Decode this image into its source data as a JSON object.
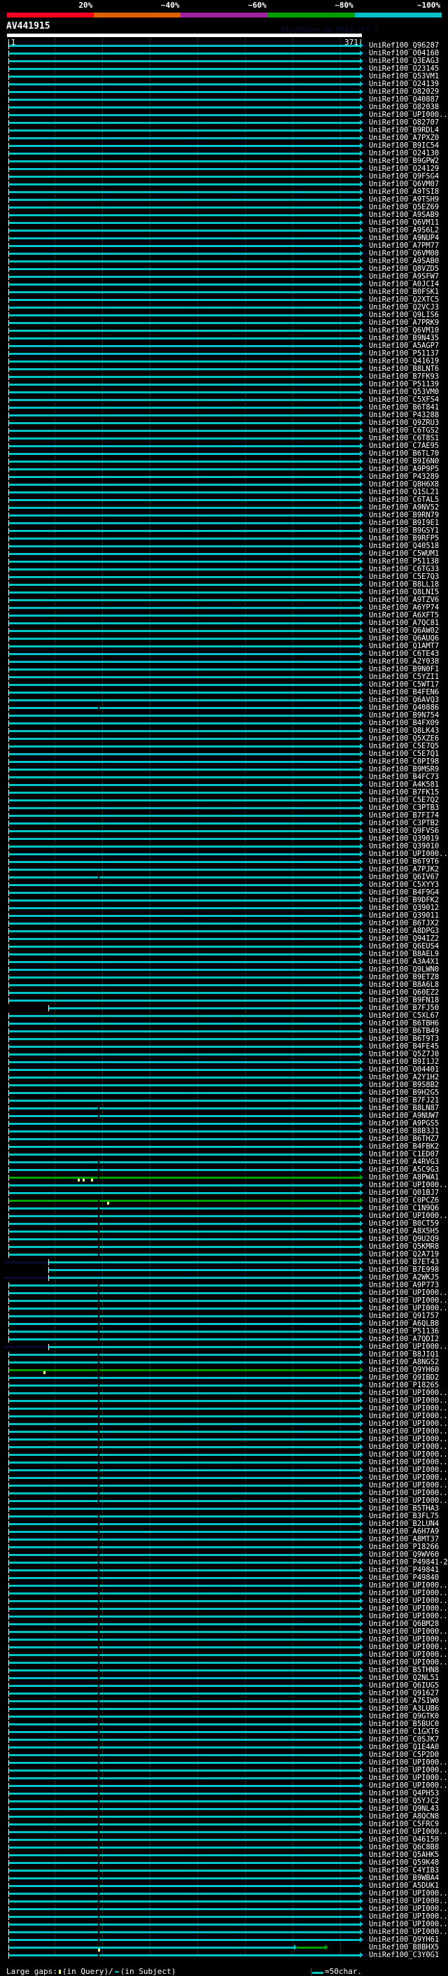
{
  "header": {
    "identity_legend": [
      {
        "label": "20%",
        "color": "#ff0020"
      },
      {
        "label": "~40%",
        "color": "#e06000"
      },
      {
        "label": "~60%",
        "color": "#a020a0"
      },
      {
        "label": "~80%",
        "color": "#00a000"
      },
      {
        "label": "~100%",
        "color": "#00c0c8"
      }
    ],
    "query_name": "AV441915",
    "version": "AlignView.pm Beta rel.7",
    "ruler_start": "|1",
    "ruler_end": "371|"
  },
  "query_length": 371,
  "grid_step": 50,
  "colors": {
    "hit": "#00c3c8",
    "green": "#00a000",
    "overhang": "#070a2e",
    "gap": "#ffff80"
  },
  "hits": [
    "UniRef100_Q96287",
    "UniRef100_O04160",
    "UniRef100_Q3EAG3",
    "UniRef100_O23145",
    "UniRef100_Q53VM1",
    "UniRef100_O24139",
    "UniRef100_O82029",
    "UniRef100_Q40887",
    "UniRef100_O82038",
    "UniRef100_UPI000..",
    "UniRef100_O82707",
    "UniRef100_B9RDL4",
    "UniRef100_A7PXZ0",
    "UniRef100_B9IC54",
    "UniRef100_O24130",
    "UniRef100_B9GPW2",
    "UniRef100_O24129",
    "UniRef100_Q9FSG4",
    "UniRef100_Q6VM07",
    "UniRef100_A9TSI8",
    "UniRef100_A9TSH9",
    "UniRef100_Q5EZ69",
    "UniRef100_A9SAB9",
    "UniRef100_Q6VM11",
    "UniRef100_A9S6L2",
    "UniRef100_A9NUP4",
    "UniRef100_A7PM77",
    "UniRef100_Q6VM08",
    "UniRef100_A9SAB0",
    "UniRef100_Q8VZD5",
    "UniRef100_A9SFW7",
    "UniRef100_A0JCI4",
    "UniRef100_B0FSK1",
    "UniRef100_Q2XTC5",
    "UniRef100_Q2VCJ3",
    "UniRef100_Q9LIS6",
    "UniRef100_A7PRK9",
    "UniRef100_Q6VM10",
    "UniRef100_B9N435",
    "UniRef100_A5AGP7",
    "UniRef100_P51137",
    "UniRef100_Q41619",
    "UniRef100_B8LNT6",
    "UniRef100_B7FK93",
    "UniRef100_P51139",
    "UniRef100_Q53VM0",
    "UniRef100_C5XFS4",
    "UniRef100_B6T841",
    "UniRef100_P43288",
    "UniRef100_Q9ZRU3",
    "UniRef100_C6TGS2",
    "UniRef100_C6T8S1",
    "UniRef100_C7AE95",
    "UniRef100_B6TL70",
    "UniRef100_B9I6N0",
    "UniRef100_A9P9P5",
    "UniRef100_P43289",
    "UniRef100_Q8H6X8",
    "UniRef100_Q1SL21",
    "UniRef100_C6TAL5",
    "UniRef100_A9NV52",
    "UniRef100_B9RN79",
    "UniRef100_B9I9E1",
    "UniRef100_B9GSY1",
    "UniRef100_B9RFP5",
    "UniRef100_Q40518",
    "UniRef100_C5WUM1",
    "UniRef100_P51138",
    "UniRef100_C6TG33",
    "UniRef100_C5E7Q3",
    "UniRef100_B8LL18",
    "UniRef100_Q8LNI5",
    "UniRef100_A9TZV6",
    "UniRef100_A6YP74",
    "UniRef100_A6XFT5",
    "UniRef100_A7QC81",
    "UniRef100_Q6AW02",
    "UniRef100_Q6AUQ6",
    "UniRef100_Q1AMT7",
    "UniRef100_C6TE43",
    "UniRef100_A2Y038",
    "UniRef100_B9N0F1",
    "UniRef100_C5YZI1",
    "UniRef100_C5WT17",
    "UniRef100_B4FEN6",
    "UniRef100_Q6AVQ3",
    "UniRef100_Q40886",
    "UniRef100_B9N754",
    "UniRef100_B4FX09",
    "UniRef100_Q8LK43",
    "UniRef100_Q5XZE6",
    "UniRef100_C5E7Q5",
    "UniRef100_C5E7Q1",
    "UniRef100_C0PI98",
    "UniRef100_B9MSR9",
    "UniRef100_B4FC73",
    "UniRef100_A4K581",
    "UniRef100_B7FK15",
    "UniRef100_C5E7Q2",
    "UniRef100_C3PTB3",
    "UniRef100_B7FI74",
    "UniRef100_C3PTB2",
    "UniRef100_Q9FVS6",
    "UniRef100_Q39019",
    "UniRef100_Q39010",
    "UniRef100_UPI000..",
    "UniRef100_B6T9T6",
    "UniRef100_A7PJK2",
    "UniRef100_Q6IV67",
    "UniRef100_C5XYY3",
    "UniRef100_B4F9G4",
    "UniRef100_B9DFK2",
    "UniRef100_Q39012",
    "UniRef100_Q39011",
    "UniRef100_B6TJX2",
    "UniRef100_A8DPG3",
    "UniRef100_Q94IZ2",
    "UniRef100_Q6EUS4",
    "UniRef100_B8AEL9",
    "UniRef100_A3A4X1",
    "UniRef100_Q9LWN0",
    "UniRef100_B9ETZ8",
    "UniRef100_B8A6L8",
    "UniRef100_Q60EZ2",
    "UniRef100_B9FN18",
    "UniRef100_B7FJ50",
    "UniRef100_C5XL67",
    "UniRef100_B6TBH6",
    "UniRef100_B6TB49",
    "UniRef100_B6T9T3",
    "UniRef100_B4FE45",
    "UniRef100_Q5Z7J0",
    "UniRef100_B9I1J2",
    "UniRef100_O04401",
    "UniRef100_A2Y1H2",
    "UniRef100_B9S8B2",
    "UniRef100_B9H2G5",
    "UniRef100_B7FJ21",
    "UniRef100_B8LN87",
    "UniRef100_A9NUW7",
    "UniRef100_A9PGS5",
    "UniRef100_B8B3J1",
    "UniRef100_B6THZ7",
    "UniRef100_B4FBK2",
    "UniRef100_C1ED07",
    "UniRef100_A4RVG3",
    "UniRef100_A5C9G3",
    "UniRef100_A8PWA1",
    "UniRef100_UPI000..",
    "UniRef100_Q01BJ7",
    "UniRef100_C0PCZ6",
    "UniRef100_C1N9Q6",
    "UniRef100_UPI000..",
    "UniRef100_B0CT59",
    "UniRef100_A8X5H5",
    "UniRef100_Q9U2Q9",
    "UniRef100_Q5KMR8",
    "UniRef100_Q2A719",
    "UniRef100_B7ET43",
    "UniRef100_B7E998",
    "UniRef100_A2WKJ5",
    "UniRef100_A9P773",
    "UniRef100_UPI000..",
    "UniRef100_UPI000..",
    "UniRef100_UPI000..",
    "UniRef100_Q91757",
    "UniRef100_A6QLB8",
    "UniRef100_P51136",
    "UniRef100_A7QDI2",
    "UniRef100_UPI000..",
    "UniRef100_B8JIQ1",
    "UniRef100_A8NGS2",
    "UniRef100_Q9YH60",
    "UniRef100_Q9IBD2",
    "UniRef100_P18265",
    "UniRef100_UPI000..",
    "UniRef100_UPI000..",
    "UniRef100_UPI000..",
    "UniRef100_UPI000..",
    "UniRef100_UPI000..",
    "UniRef100_UPI000..",
    "UniRef100_UPI000..",
    "UniRef100_UPI000..",
    "UniRef100_UPI000..",
    "UniRef100_UPI000..",
    "UniRef100_UPI000..",
    "UniRef100_UPI000..",
    "UniRef100_UPI000..",
    "UniRef100_UPI000..",
    "UniRef100_UPI000..",
    "UniRef100_B5THA3",
    "UniRef100_B3FL75",
    "UniRef100_B2LUN4",
    "UniRef100_A6H7A9",
    "UniRef100_A8MT37",
    "UniRef100_P18266",
    "UniRef100_Q9WV60",
    "UniRef100_P49841-2",
    "UniRef100_P49841",
    "UniRef100_P49840",
    "UniRef100_UPI000..",
    "UniRef100_UPI000..",
    "UniRef100_UPI000..",
    "UniRef100_UPI000..",
    "UniRef100_UPI000..",
    "UniRef100_Q6BM28",
    "UniRef100_UPI000..",
    "UniRef100_UPI000..",
    "UniRef100_UPI000..",
    "UniRef100_UPI000..",
    "UniRef100_UPI000..",
    "UniRef100_B5THN8",
    "UniRef100_Q2NL51",
    "UniRef100_Q6IUG5",
    "UniRef100_Q91627",
    "UniRef100_A7SIW0",
    "UniRef100_A3LUB6",
    "UniRef100_Q9GTK0",
    "UniRef100_B5BUC0",
    "UniRef100_C1GXT6",
    "UniRef100_C0SJK7",
    "UniRef100_Q1E4A0",
    "UniRef100_C5P2D0",
    "UniRef100_UPI000..",
    "UniRef100_UPI000..",
    "UniRef100_UPI000..",
    "UniRef100_UPI000..",
    "UniRef100_Q4PH53",
    "UniRef100_Q5YJC2",
    "UniRef100_Q9NL43",
    "UniRef100_A8QCN8",
    "UniRef100_C5FRC9",
    "UniRef100_UPI000..",
    "UniRef100_O46150",
    "UniRef100_Q6C8B8",
    "UniRef100_Q5AHK5",
    "UniRef100_Q59K48",
    "UniRef100_C4YIB3",
    "UniRef100_B9WBA4",
    "UniRef100_A5DUK1",
    "UniRef100_UPI000..",
    "UniRef100_UPI000..",
    "UniRef100_UPI000..",
    "UniRef100_UPI000..",
    "UniRef100_UPI000..",
    "UniRef100_UPI000..",
    "UniRef100_Q9YH61",
    "UniRef100_B8BHX5",
    "UniRef100_C3Y0G1"
  ],
  "hit_overrides": {
    "125": {
      "start": 43
    },
    "147": {
      "color": "green",
      "query_gaps": [
        74,
        79,
        88
      ]
    },
    "150": {
      "color": "green",
      "query_gaps": [
        105
      ]
    },
    "158": {
      "start": 43,
      "overhang_left": true
    },
    "159": {
      "start": 43
    },
    "160": {
      "start": 43,
      "overhang_left": true
    },
    "169": {
      "start": 43,
      "overhang_left": true
    },
    "172": {
      "color": "green",
      "query_gaps": [
        38
      ]
    },
    "247": {
      "end": 302,
      "green_to": 334,
      "query_gaps": [
        95
      ]
    }
  },
  "subject_gap_residue": 95,
  "subject_gap_rows_extra": [
    86,
    108,
    138,
    139,
    145,
    146,
    147
  ],
  "subject_gap_from_row": 150,
  "subject_gap_exclude": [
    158,
    159,
    160,
    169,
    190
  ],
  "footer": {
    "large_gaps_label": "Large gaps:",
    "in_query": "(in Query)/",
    "in_subject": "(in Subject)",
    "scale_label": "=50char."
  }
}
